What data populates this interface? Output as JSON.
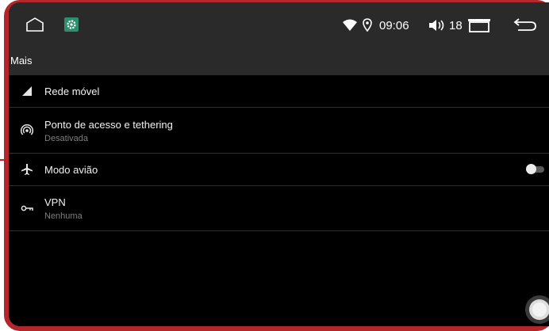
{
  "colors": {
    "frame": "#b3262a",
    "bar_background": "#2a2a2a",
    "screen_background": "#000000",
    "primary_text": "#f2f2f2",
    "secondary_text": "#7f7f7f",
    "settings_icon_bg": "#2c8f6e"
  },
  "status_bar": {
    "icons_left": [
      "home-icon",
      "settings-app-icon"
    ],
    "icons_right": [
      "wifi-icon",
      "location-icon",
      "volume-icon",
      "recents-icon",
      "back-icon"
    ],
    "time": "09:06",
    "volume_level": "18"
  },
  "app_bar": {
    "title": "Mais"
  },
  "settings": [
    {
      "icon": "signal-icon",
      "title": "Rede móvel",
      "subtitle": ""
    },
    {
      "icon": "hotspot-icon",
      "title": "Ponto de acesso e tethering",
      "subtitle": "Desativada"
    },
    {
      "icon": "airplane-icon",
      "title": "Modo avião",
      "subtitle": "",
      "toggle": "off"
    },
    {
      "icon": "vpn-key-icon",
      "title": "VPN",
      "subtitle": "Nenhuma"
    }
  ]
}
